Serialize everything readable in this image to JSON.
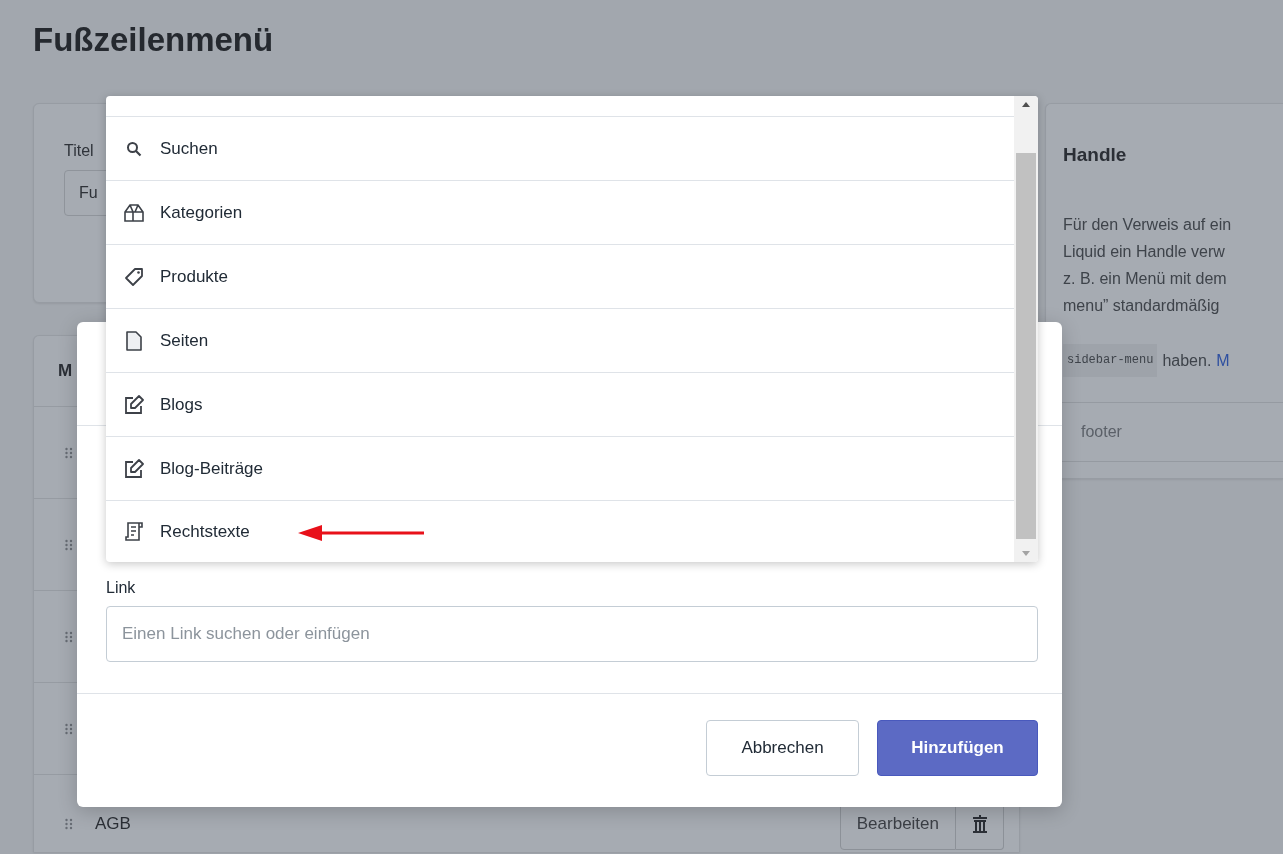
{
  "page": {
    "title": "Fußzeilenmenü"
  },
  "title_card": {
    "label": "Titel",
    "value": "Fu"
  },
  "menu_card": {
    "heading": "M",
    "items": [
      {
        "handle": true
      },
      {
        "handle": true
      },
      {
        "handle": true
      },
      {
        "handle": true
      },
      {
        "handle": true,
        "label": "AGB",
        "edit_button": "Bearbeiten",
        "delete": true
      }
    ]
  },
  "handle_card": {
    "heading": "Handle",
    "lines": [
      "Für den Verweis auf ein",
      "Liquid ein Handle verw",
      "z. B. ein Menü mit dem",
      "menu” standardmäßig"
    ],
    "code": "sidebar-menu",
    "after_code": "haben.",
    "link": "M",
    "value": "footer"
  },
  "modal": {
    "link_label": "Link",
    "link_placeholder": "Einen Link suchen oder einfügen",
    "cancel": "Abbrechen",
    "submit": "Hinzufügen"
  },
  "dropdown": {
    "items": [
      {
        "label": "Suchen",
        "kind": "search"
      },
      {
        "label": "Kategorien",
        "kind": "collection"
      },
      {
        "label": "Produkte",
        "kind": "product"
      },
      {
        "label": "Seiten",
        "kind": "page"
      },
      {
        "label": "Blogs",
        "kind": "blog"
      },
      {
        "label": "Blog-Beiträge",
        "kind": "article"
      },
      {
        "label": "Rechtstexte",
        "kind": "policy"
      }
    ]
  }
}
